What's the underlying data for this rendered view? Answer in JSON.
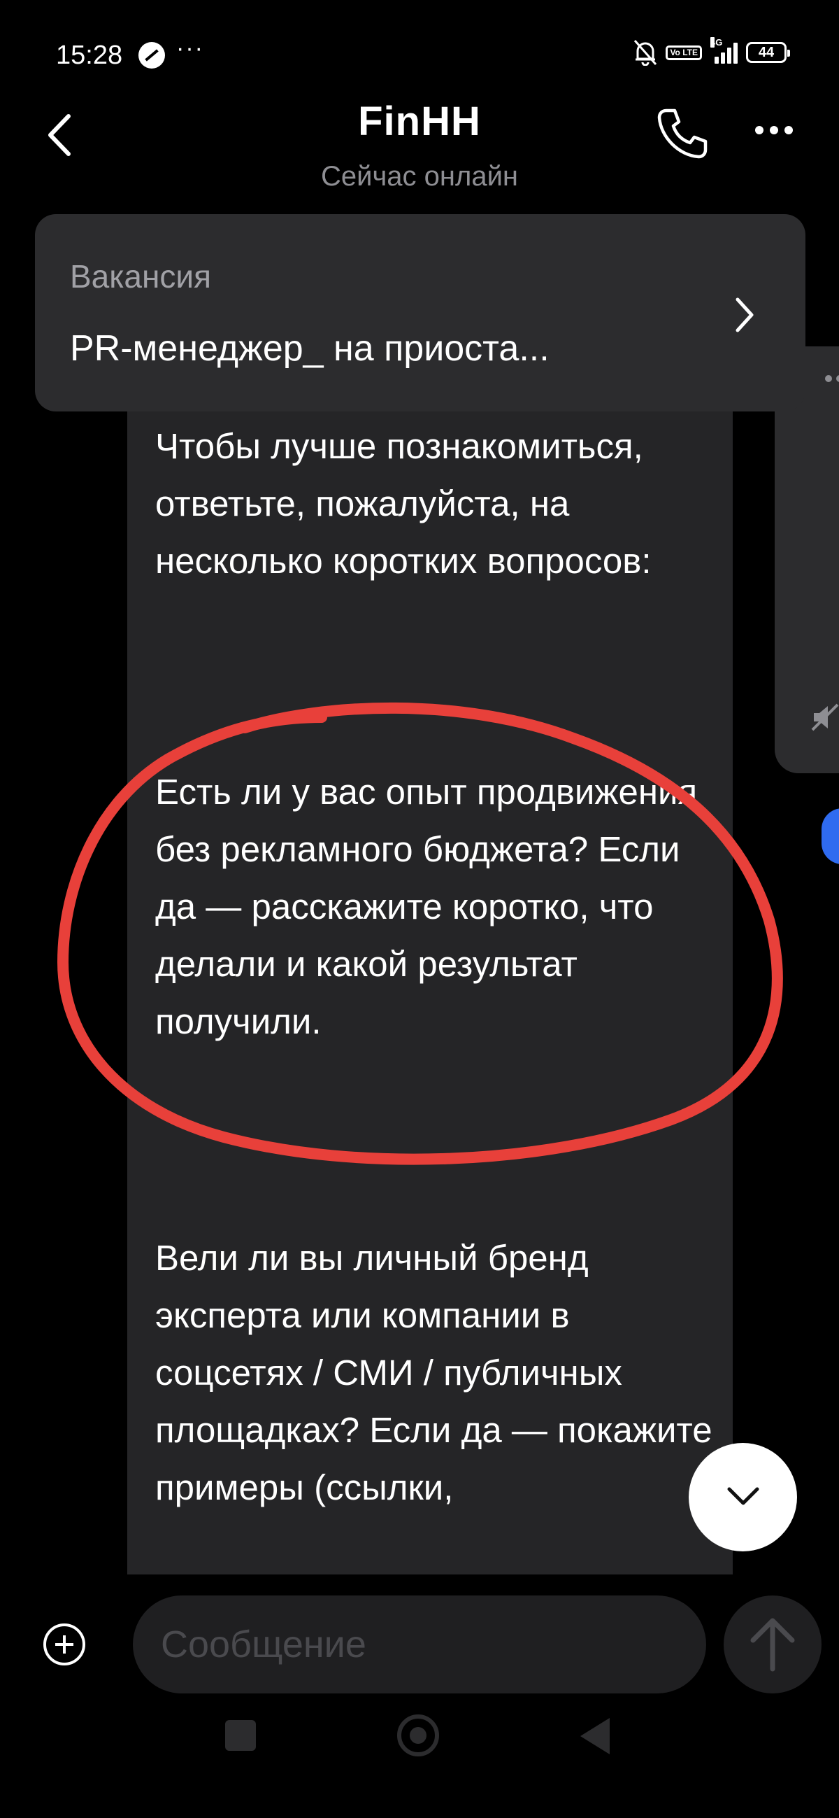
{
  "status_bar": {
    "time": "15:28",
    "more": "···",
    "volte": "Vo LTE",
    "network": "4G",
    "battery": "44"
  },
  "header": {
    "title": "FinHH",
    "subtitle": "Сейчас онлайн"
  },
  "vacancy": {
    "label": "Вакансия",
    "title": "PR-менеджер_ на приоста..."
  },
  "message": {
    "paragraph_1": "Чтобы лучше познакомиться, ответьте, пожалуйста, на несколько коротких вопросов:",
    "paragraph_2": "Есть ли у вас опыт продвижения без рекламного бюджета? Если да — расскажите коротко, что делали и какой результат получили.",
    "paragraph_3": "Вели ли вы личный бренд эксперта или компании в соцсетях / СМИ / публичных площадках? Если да — покажите примеры (ссылки,"
  },
  "composer": {
    "placeholder": "Сообщение"
  },
  "colors": {
    "background": "#000000",
    "bubble": "#252527",
    "card": "#2c2c2e",
    "highlight": "#e8403a",
    "secondary_text": "#8e8e93"
  }
}
